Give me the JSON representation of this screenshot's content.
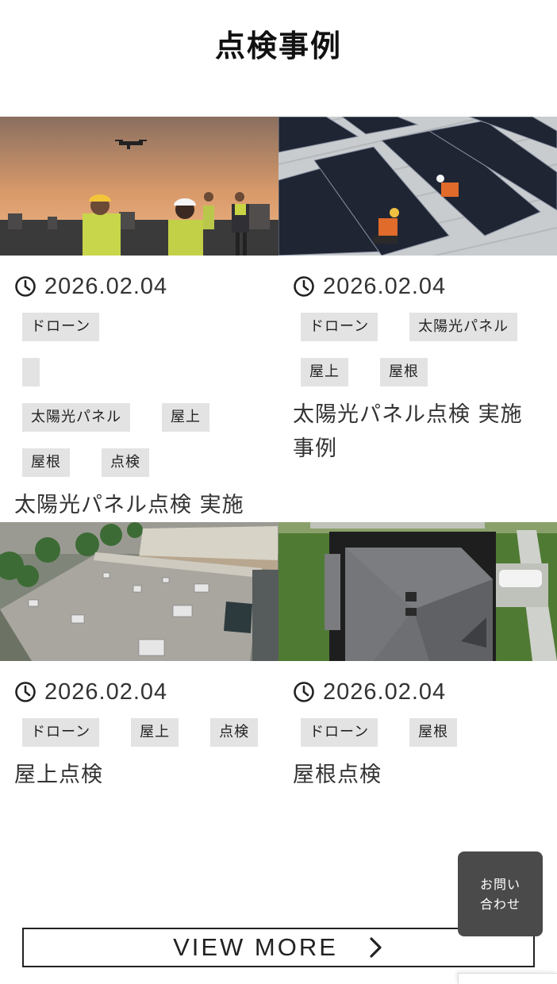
{
  "page": {
    "title": "点検事例"
  },
  "cards": [
    {
      "date": "2026.02.04",
      "tags": [
        "ドローン",
        "太陽光パネル",
        "屋上",
        "屋根",
        "点検"
      ],
      "title": "太陽光パネル点検 実施事例",
      "image": "drone-inspection-team-at-sunset"
    },
    {
      "date": "2026.02.04",
      "tags": [
        "ドローン",
        "太陽光パネル",
        "屋上",
        "屋根"
      ],
      "title": "太陽光パネル点検 実施事例",
      "image": "workers-on-solar-roof"
    },
    {
      "date": "2026.02.04",
      "tags": [
        "ドローン",
        "屋上",
        "点検"
      ],
      "title": "屋上点検",
      "image": "aerial-flat-rooftop"
    },
    {
      "date": "2026.02.04",
      "tags": [
        "ドローン",
        "屋根"
      ],
      "title": "屋根点検",
      "image": "aerial-shingle-roof-house"
    }
  ],
  "contact": {
    "label": "お問い合わせ"
  },
  "view_more": {
    "label": "VIEW MORE"
  },
  "colors": {
    "tag_bg": "#e3e3e3",
    "contact_bg": "#4a4a4a",
    "text": "#222222"
  },
  "icons": {
    "date": "clock-icon",
    "more": "chevron-right-icon"
  }
}
